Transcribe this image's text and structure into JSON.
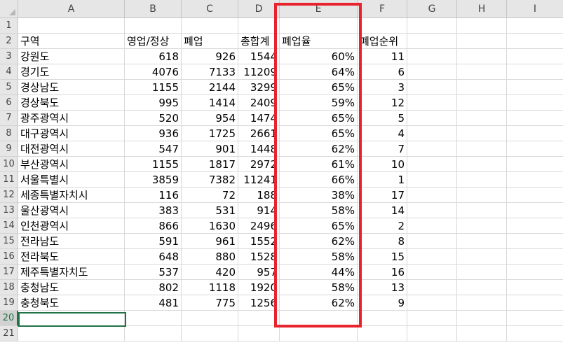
{
  "columns": [
    {
      "letter": "A"
    },
    {
      "letter": "B"
    },
    {
      "letter": "C"
    },
    {
      "letter": "D"
    },
    {
      "letter": "E"
    },
    {
      "letter": "F"
    },
    {
      "letter": "G"
    },
    {
      "letter": "H"
    },
    {
      "letter": "I"
    }
  ],
  "row_numbers": [
    "1",
    "2",
    "3",
    "4",
    "5",
    "6",
    "7",
    "8",
    "9",
    "10",
    "11",
    "12",
    "13",
    "14",
    "15",
    "16",
    "17",
    "18",
    "19",
    "20",
    "21"
  ],
  "selected_row": "20",
  "headers": {
    "a": "구역",
    "b": "영업/정상",
    "c": "폐업",
    "d": "총합계",
    "e": "폐업율",
    "f": "폐업순위"
  },
  "rows": [
    {
      "a": "강원도",
      "b": "618",
      "c": "926",
      "d": "1544",
      "e": "60%",
      "f": "11"
    },
    {
      "a": "경기도",
      "b": "4076",
      "c": "7133",
      "d": "11209",
      "e": "64%",
      "f": "6"
    },
    {
      "a": "경상남도",
      "b": "1155",
      "c": "2144",
      "d": "3299",
      "e": "65%",
      "f": "3"
    },
    {
      "a": "경상북도",
      "b": "995",
      "c": "1414",
      "d": "2409",
      "e": "59%",
      "f": "12"
    },
    {
      "a": "광주광역시",
      "b": "520",
      "c": "954",
      "d": "1474",
      "e": "65%",
      "f": "5"
    },
    {
      "a": "대구광역시",
      "b": "936",
      "c": "1725",
      "d": "2661",
      "e": "65%",
      "f": "4"
    },
    {
      "a": "대전광역시",
      "b": "547",
      "c": "901",
      "d": "1448",
      "e": "62%",
      "f": "7"
    },
    {
      "a": "부산광역시",
      "b": "1155",
      "c": "1817",
      "d": "2972",
      "e": "61%",
      "f": "10"
    },
    {
      "a": "서울특별시",
      "b": "3859",
      "c": "7382",
      "d": "11241",
      "e": "66%",
      "f": "1"
    },
    {
      "a": "세종특별자치시",
      "b": "116",
      "c": "72",
      "d": "188",
      "e": "38%",
      "f": "17"
    },
    {
      "a": "울산광역시",
      "b": "383",
      "c": "531",
      "d": "914",
      "e": "58%",
      "f": "14"
    },
    {
      "a": "인천광역시",
      "b": "866",
      "c": "1630",
      "d": "2496",
      "e": "65%",
      "f": "2"
    },
    {
      "a": "전라남도",
      "b": "591",
      "c": "961",
      "d": "1552",
      "e": "62%",
      "f": "8"
    },
    {
      "a": "전라북도",
      "b": "648",
      "c": "880",
      "d": "1528",
      "e": "58%",
      "f": "15"
    },
    {
      "a": "제주특별자치도",
      "b": "537",
      "c": "420",
      "d": "957",
      "e": "44%",
      "f": "16"
    },
    {
      "a": "충청남도",
      "b": "802",
      "c": "1118",
      "d": "1920",
      "e": "58%",
      "f": "13"
    },
    {
      "a": "충청북도",
      "b": "481",
      "c": "775",
      "d": "1256",
      "e": "62%",
      "f": "9"
    }
  ],
  "colors": {
    "highlight": "#e8232d",
    "selection": "#217346"
  }
}
